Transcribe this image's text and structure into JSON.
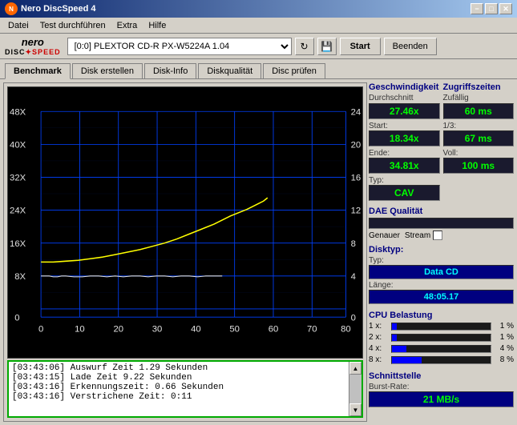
{
  "window": {
    "title": "Nero DiscSpeed 4",
    "minimize": "−",
    "maximize": "□",
    "close": "✕"
  },
  "menu": {
    "items": [
      "Datei",
      "Test durchführen",
      "Extra",
      "Hilfe"
    ]
  },
  "toolbar": {
    "logo_nero": "nero",
    "logo_disc": "DISC",
    "logo_speed": "SPEED",
    "drive_value": "[0:0]  PLEXTOR CD-R  PX-W5224A 1.04",
    "start_label": "Start",
    "end_label": "Beenden"
  },
  "tabs": {
    "items": [
      "Benchmark",
      "Disk erstellen",
      "Disk-Info",
      "Diskqualität",
      "Disc prüfen"
    ],
    "active": 0
  },
  "geschwindigkeit": {
    "title": "Geschwindigkeit",
    "durchschnitt_label": "Durchschnitt",
    "durchschnitt_value": "27.46x",
    "start_label": "Start:",
    "start_value": "18.34x",
    "ende_label": "Ende:",
    "ende_value": "34.81x",
    "typ_label": "Typ:",
    "typ_value": "CAV"
  },
  "zugriffszeiten": {
    "title": "Zugriffszeiten",
    "zufaellig_label": "Zufällig",
    "zufaellig_value": "60 ms",
    "onethird_label": "1/3:",
    "onethird_value": "67 ms",
    "voll_label": "Voll:",
    "voll_value": "100 ms"
  },
  "dae": {
    "title": "DAE Qualität",
    "genauer_label": "Genauer",
    "stream_label": "Stream"
  },
  "disktyp": {
    "title": "Disktyp:",
    "typ_label": "Typ:",
    "typ_value": "Data CD",
    "laenge_label": "Länge:",
    "laenge_value": "48:05.17"
  },
  "cpu": {
    "title": "CPU Belastung",
    "rows": [
      {
        "label": "1 x:",
        "pct": "1 %",
        "fill": 5
      },
      {
        "label": "2 x:",
        "pct": "1 %",
        "fill": 5
      },
      {
        "label": "4 x:",
        "pct": "4 %",
        "fill": 15
      },
      {
        "label": "8 x:",
        "pct": "8 %",
        "fill": 30
      }
    ]
  },
  "schnittstelle": {
    "title": "Schnittstelle",
    "burst_label": "Burst-Rate:",
    "burst_value": "21 MB/s"
  },
  "log": {
    "lines": [
      "[03:43:06]  Auswurf Zeit 1.29 Sekunden",
      "[03:43:15]  Lade Zeit 9.22 Sekunden",
      "[03:43:16]  Erkennungszeit: 0.66 Sekunden",
      "[03:43:16]  Verstrichene Zeit: 0:11"
    ]
  },
  "chart": {
    "left_axis": [
      "48X",
      "40X",
      "32X",
      "24X",
      "16X",
      "8X",
      "0"
    ],
    "right_axis": [
      "24",
      "20",
      "16",
      "12",
      "8",
      "4",
      "0"
    ],
    "bottom_axis": [
      "0",
      "10",
      "20",
      "30",
      "40",
      "50",
      "60",
      "70",
      "80"
    ],
    "left_max": 48,
    "right_max": 24
  }
}
